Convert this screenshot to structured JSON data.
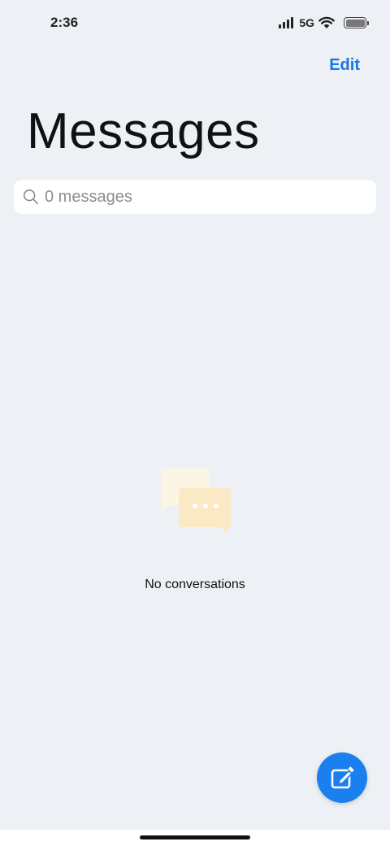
{
  "status_bar": {
    "time": "2:36",
    "network": "5G"
  },
  "header": {
    "edit_label": "Edit",
    "title": "Messages"
  },
  "search": {
    "placeholder": "0 messages",
    "value": ""
  },
  "empty_state": {
    "text": "No conversations",
    "icon": "chat-bubbles-icon"
  },
  "compose": {
    "icon": "compose-icon"
  },
  "colors": {
    "accent": "#1a73e8",
    "fab": "#1a80f0",
    "background": "#edf0f4",
    "empty_icon_light": "#fdf5e4",
    "empty_icon_dark": "#fbe9c6"
  }
}
